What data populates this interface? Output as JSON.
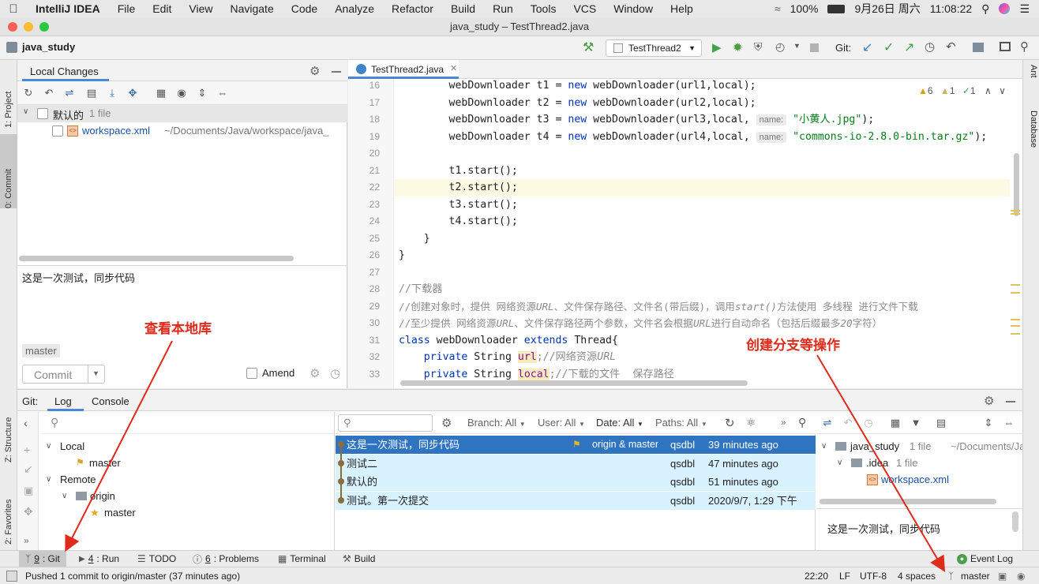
{
  "menubar": {
    "app": "IntelliJ IDEA",
    "items": [
      "File",
      "Edit",
      "View",
      "Navigate",
      "Code",
      "Analyze",
      "Refactor",
      "Build",
      "Run",
      "Tools",
      "VCS",
      "Window",
      "Help"
    ],
    "battery": "100%",
    "date": "9月26日 周六",
    "time": "11:08:22"
  },
  "window_title": "java_study – TestThread2.java",
  "project_name": "java_study",
  "run_config": "TestThread2",
  "git_label": "Git:",
  "left_stripe": {
    "project": "1: Project",
    "commit": "0: Commit",
    "structure": "Z: Structure",
    "favorites": "2: Favorites"
  },
  "right_stripe": {
    "ant": "Ant",
    "database": "Database"
  },
  "commit_panel": {
    "tab": "Local Changes",
    "changelist": "默认的",
    "changelist_count": "1 file",
    "file_name": "workspace.xml",
    "file_path": "~/Documents/Java/workspace/java_",
    "message": "这是一次测试，同步代码",
    "branch": "master",
    "commit_button": "Commit",
    "amend_label": "Amend"
  },
  "editor": {
    "tab": "TestThread2.java",
    "inspections": {
      "warnings": "6",
      "weak": "1",
      "ok": "1"
    },
    "lines": [
      {
        "n": "16"
      },
      {
        "n": "17"
      },
      {
        "n": "18"
      },
      {
        "n": "19"
      },
      {
        "n": "20"
      },
      {
        "n": "21"
      },
      {
        "n": "22"
      },
      {
        "n": "23"
      },
      {
        "n": "24"
      },
      {
        "n": "25"
      },
      {
        "n": "26"
      },
      {
        "n": "27"
      },
      {
        "n": "28"
      },
      {
        "n": "29"
      },
      {
        "n": "30"
      },
      {
        "n": "31"
      },
      {
        "n": "32"
      },
      {
        "n": "33"
      }
    ],
    "code": {
      "l16a": "        webDownloader t1 = ",
      "l16k": "new",
      "l16b": " webDownloader(url1,local);",
      "l17a": "        webDownloader t2 = ",
      "l17k": "new",
      "l17b": " webDownloader(url2,local);",
      "l18a": "        webDownloader t3 = ",
      "l18k": "new",
      "l18b": " webDownloader(url3,local, ",
      "l18h": "name:",
      "l18s": "\"小黄人.jpg\"",
      "l18e": ");",
      "l19a": "        webDownloader t4 = ",
      "l19k": "new",
      "l19b": " webDownloader(url4,local, ",
      "l19h": "name:",
      "l19s": "\"commons-io-2.8.0-bin.tar.gz\"",
      "l19e": ");",
      "l21": "        t1.start();",
      "l22": "        t2.start();",
      "l23": "        t3.start();",
      "l24": "        t4.start();",
      "l25": "    }",
      "l26": "}",
      "l28": "//下载器",
      "l29a": "//创建对象时，提供 网络资源",
      "l29b": "URL",
      "l29c": "、文件保存路径、文件名(带后缀)，调用",
      "l29d": "start()",
      "l29e": "方法使用 多线程 进行文件下载",
      "l30a": "//至少提供 网络资源",
      "l30b": "URL",
      "l30c": "、文件保存路径两个参数，文件名会根据",
      "l30d": "URL",
      "l30e": "进行自动命名（包括后缀最多",
      "l30f": "20",
      "l30g": "字符）",
      "l31k1": "class",
      "l31a": " webDownloader ",
      "l31k2": "extends",
      "l31b": " Thread{",
      "l32k": "    private",
      "l32a": " String ",
      "l32u": "url",
      "l32c": ";//网络资源",
      "l32d": "URL",
      "l33k": "    private",
      "l33a": " String ",
      "l33u": "local",
      "l33c": ";//下载的文件  保存路径"
    }
  },
  "annotations": {
    "left": "查看本地库",
    "right": "创建分支等操作"
  },
  "git_panel": {
    "title": "Git:",
    "tabs": [
      "Log",
      "Console"
    ],
    "tree": {
      "local": "Local",
      "local_master": "master",
      "remote": "Remote",
      "origin": "origin",
      "origin_master": "master"
    },
    "filters": {
      "branch": "Branch: All",
      "user": "User: All",
      "date": "Date: All",
      "paths": "Paths: All"
    },
    "commits": [
      {
        "msg": "这是一次测试，同步代码",
        "tags": "origin & master",
        "author": "qsdbl",
        "time": "39 minutes ago"
      },
      {
        "msg": "测试二",
        "tags": "",
        "author": "qsdbl",
        "time": "47 minutes ago"
      },
      {
        "msg": "默认的",
        "tags": "",
        "author": "qsdbl",
        "time": "51 minutes ago"
      },
      {
        "msg": "测试。第一次提交",
        "tags": "",
        "author": "qsdbl",
        "time": "2020/9/7, 1:29 下午"
      }
    ],
    "details": {
      "root": "java_study",
      "root_count": "1 file",
      "root_path": "~/Documents/Ja",
      "idea": ".idea",
      "idea_count": "1 file",
      "file": "workspace.xml",
      "message": "这是一次测试，同步代码"
    }
  },
  "bottom_tabs": [
    {
      "key": "9",
      "label": ": Git"
    },
    {
      "key": "4",
      "label": ": Run"
    },
    {
      "key": "",
      "label": "TODO"
    },
    {
      "key": "6",
      "label": ": Problems"
    },
    {
      "key": "",
      "label": "Terminal"
    },
    {
      "key": "",
      "label": "Build"
    }
  ],
  "event_log": "Event Log",
  "status": {
    "message": "Pushed 1 commit to origin/master (37 minutes ago)",
    "position": "22:20",
    "line_sep": "LF",
    "encoding": "UTF-8",
    "indent": "4 spaces",
    "branch": "master"
  }
}
